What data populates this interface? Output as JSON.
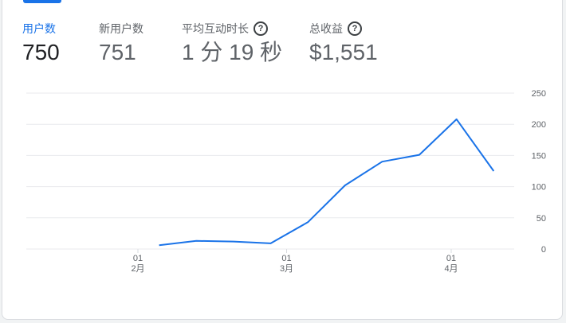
{
  "metrics": [
    {
      "label": "用户数",
      "value": "750",
      "help": false
    },
    {
      "label": "新用户数",
      "value": "751",
      "help": false
    },
    {
      "label": "平均互动时长",
      "value": "1 分 19 秒",
      "help": true
    },
    {
      "label": "总收益",
      "value": "$1,551",
      "help": true
    }
  ],
  "help_glyph": "?",
  "colors": {
    "accent": "#1a73e8",
    "line": "#1a73e8",
    "grid": "#e8eaed"
  },
  "chart_data": {
    "type": "line",
    "title": "",
    "xlabel": "",
    "ylabel": "",
    "ylim": [
      0,
      250
    ],
    "yticks": [
      "0",
      "50",
      "100",
      "150",
      "200",
      "250"
    ],
    "xticks": [
      {
        "day": "01",
        "month": "2月",
        "x": "2月1日"
      },
      {
        "day": "01",
        "month": "3月",
        "x": "3月1日"
      },
      {
        "day": "01",
        "month": "4月",
        "x": "4月1日"
      }
    ],
    "grid": true,
    "series": [
      {
        "x": [
          "2月5日",
          "2月12日",
          "2月19日",
          "2月26日",
          "3月5日",
          "3月12日",
          "3月19日",
          "3月26日",
          "4月2日",
          "4月9日"
        ],
        "values": [
          6,
          13,
          12,
          9,
          43,
          102,
          140,
          151,
          208,
          125
        ]
      }
    ]
  }
}
